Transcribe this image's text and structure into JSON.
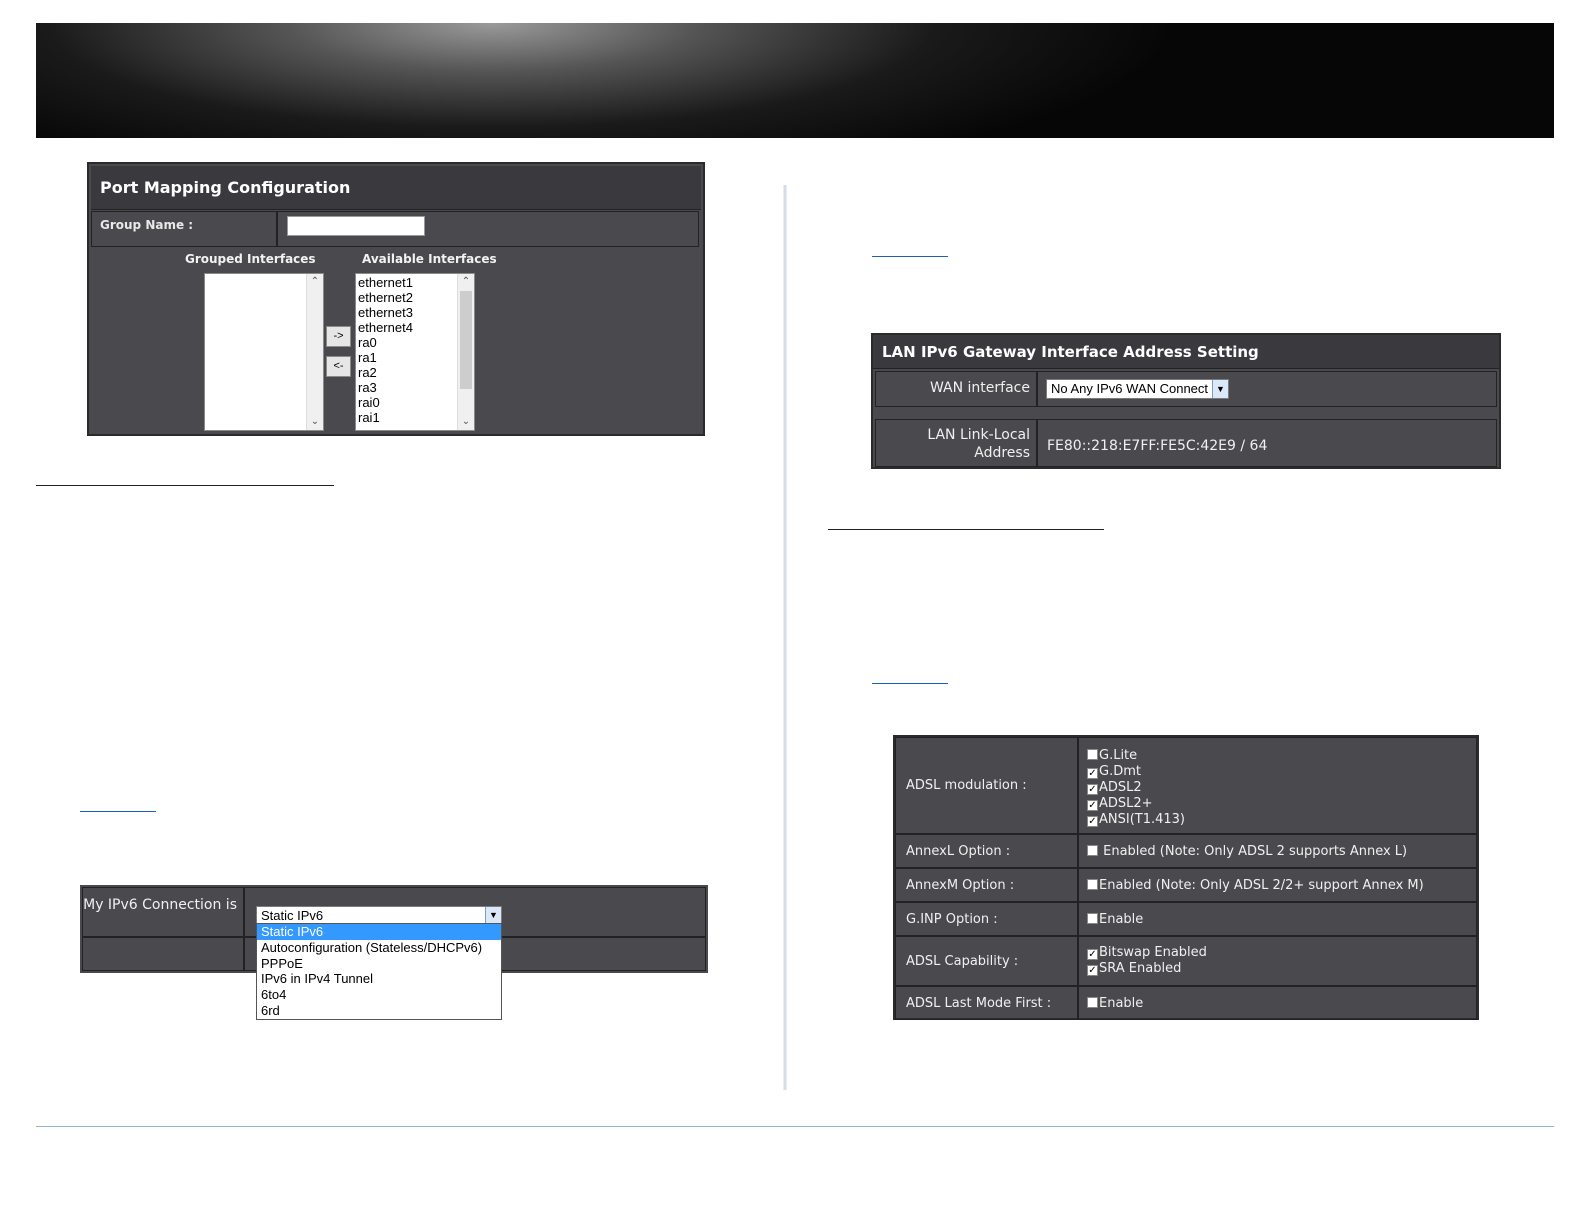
{
  "port_mapping": {
    "title": "Port Mapping Configuration",
    "group_name_label": "Group Name :",
    "group_name_value": "",
    "grouped_header": "Grouped Interfaces",
    "available_header": "Available Interfaces",
    "grouped_items": [],
    "available_items": [
      "ethernet1",
      "ethernet2",
      "ethernet3",
      "ethernet4",
      "ra0",
      "ra1",
      "ra2",
      "ra3",
      "rai0",
      "rai1"
    ],
    "add_button": "->",
    "remove_button": "<-"
  },
  "ipv6_connection": {
    "label": "My IPv6 Connection is",
    "selected": "Static IPv6",
    "options": [
      "Static IPv6",
      "Autoconfiguration (Stateless/DHCPv6)",
      "PPPoE",
      "IPv6 in IPv4 Tunnel",
      "6to4",
      "6rd"
    ]
  },
  "lan_ipv6": {
    "title": "LAN IPv6 Gateway Interface Address Setting",
    "wan_label": "WAN interface",
    "wan_value": "No Any IPv6 WAN Connect",
    "link_local_label": "LAN Link-Local Address",
    "link_local_value": "FE80::218:E7FF:FE5C:42E9 / 64"
  },
  "adsl": {
    "modulation_label": "ADSL modulation :",
    "modulation": [
      {
        "label": "G.Lite",
        "checked": false
      },
      {
        "label": "G.Dmt",
        "checked": true
      },
      {
        "label": "ADSL2",
        "checked": true
      },
      {
        "label": "ADSL2+",
        "checked": true
      },
      {
        "label": "ANSI(T1.413)",
        "checked": true
      }
    ],
    "annexl_label": "AnnexL Option :",
    "annexl_text": "Enabled (Note: Only ADSL 2 supports Annex L)",
    "annexl_checked": false,
    "annexm_label": "AnnexM Option :",
    "annexm_text": "Enabled (Note: Only ADSL 2/2+ support Annex M)",
    "annexm_checked": false,
    "ginp_label": "G.INP Option :",
    "ginp_text": "Enable",
    "ginp_checked": false,
    "capability_label": "ADSL Capability :",
    "capability": [
      {
        "label": "Bitswap Enabled",
        "checked": true
      },
      {
        "label": "SRA Enabled",
        "checked": true
      }
    ],
    "lastmode_label": "ADSL Last Mode First :",
    "lastmode_text": "Enable",
    "lastmode_checked": false
  }
}
